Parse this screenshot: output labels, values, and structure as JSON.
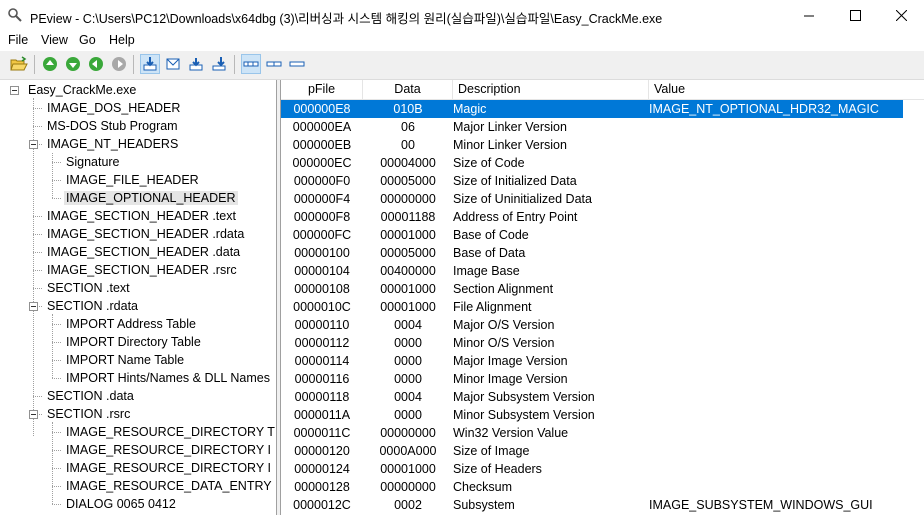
{
  "window": {
    "title": "PEview - C:\\Users\\PC12\\Downloads\\x64dbg (3)\\리버싱과 시스템 해킹의 원리(실습파일)\\실습파일\\Easy_CrackMe.exe"
  },
  "menu": [
    "File",
    "View",
    "Go",
    "Help"
  ],
  "toolbar_icons": [
    "open-icon",
    "back-icon",
    "forward-icon",
    "back-alt-icon",
    "forward-disabled-icon",
    "view-down-icon",
    "view-mail-icon",
    "view-down2-icon",
    "view-down3-icon",
    "list-mode-1-icon",
    "list-mode-2-icon",
    "list-mode-3-icon"
  ],
  "tree": [
    {
      "label": "Easy_CrackMe.exe",
      "level": 0,
      "toggle": true
    },
    {
      "label": "IMAGE_DOS_HEADER",
      "level": 1
    },
    {
      "label": "MS-DOS Stub Program",
      "level": 1
    },
    {
      "label": "IMAGE_NT_HEADERS",
      "level": 1,
      "toggle": true
    },
    {
      "label": "Signature",
      "level": 2
    },
    {
      "label": "IMAGE_FILE_HEADER",
      "level": 2
    },
    {
      "label": "IMAGE_OPTIONAL_HEADER",
      "level": 2,
      "selected": true
    },
    {
      "label": "IMAGE_SECTION_HEADER .text",
      "level": 1
    },
    {
      "label": "IMAGE_SECTION_HEADER .rdata",
      "level": 1
    },
    {
      "label": "IMAGE_SECTION_HEADER .data",
      "level": 1
    },
    {
      "label": "IMAGE_SECTION_HEADER .rsrc",
      "level": 1
    },
    {
      "label": "SECTION .text",
      "level": 1
    },
    {
      "label": "SECTION .rdata",
      "level": 1,
      "toggle": true
    },
    {
      "label": "IMPORT Address Table",
      "level": 2
    },
    {
      "label": "IMPORT Directory Table",
      "level": 2
    },
    {
      "label": "IMPORT Name Table",
      "level": 2
    },
    {
      "label": "IMPORT Hints/Names & DLL Names",
      "level": 2
    },
    {
      "label": "SECTION .data",
      "level": 1
    },
    {
      "label": "SECTION .rsrc",
      "level": 1,
      "toggle": true
    },
    {
      "label": "IMAGE_RESOURCE_DIRECTORY T",
      "level": 2
    },
    {
      "label": "IMAGE_RESOURCE_DIRECTORY I",
      "level": 2
    },
    {
      "label": "IMAGE_RESOURCE_DIRECTORY I",
      "level": 2
    },
    {
      "label": "IMAGE_RESOURCE_DATA_ENTRY",
      "level": 2
    },
    {
      "label": "DIALOG  0065  0412",
      "level": 2
    }
  ],
  "list": {
    "columns": [
      "pFile",
      "Data",
      "Description",
      "Value"
    ],
    "rows": [
      {
        "pfile": "000000E8",
        "data": "010B",
        "desc": "Magic",
        "value": "IMAGE_NT_OPTIONAL_HDR32_MAGIC",
        "selected": true
      },
      {
        "pfile": "000000EA",
        "data": "06",
        "desc": "Major Linker Version",
        "value": ""
      },
      {
        "pfile": "000000EB",
        "data": "00",
        "desc": "Minor Linker Version",
        "value": ""
      },
      {
        "pfile": "000000EC",
        "data": "00004000",
        "desc": "Size of Code",
        "value": ""
      },
      {
        "pfile": "000000F0",
        "data": "00005000",
        "desc": "Size of Initialized Data",
        "value": ""
      },
      {
        "pfile": "000000F4",
        "data": "00000000",
        "desc": "Size of Uninitialized Data",
        "value": ""
      },
      {
        "pfile": "000000F8",
        "data": "00001188",
        "desc": "Address of Entry Point",
        "value": ""
      },
      {
        "pfile": "000000FC",
        "data": "00001000",
        "desc": "Base of Code",
        "value": ""
      },
      {
        "pfile": "00000100",
        "data": "00005000",
        "desc": "Base of Data",
        "value": ""
      },
      {
        "pfile": "00000104",
        "data": "00400000",
        "desc": "Image Base",
        "value": ""
      },
      {
        "pfile": "00000108",
        "data": "00001000",
        "desc": "Section Alignment",
        "value": ""
      },
      {
        "pfile": "0000010C",
        "data": "00001000",
        "desc": "File Alignment",
        "value": ""
      },
      {
        "pfile": "00000110",
        "data": "0004",
        "desc": "Major O/S Version",
        "value": ""
      },
      {
        "pfile": "00000112",
        "data": "0000",
        "desc": "Minor O/S Version",
        "value": ""
      },
      {
        "pfile": "00000114",
        "data": "0000",
        "desc": "Major Image Version",
        "value": ""
      },
      {
        "pfile": "00000116",
        "data": "0000",
        "desc": "Minor Image Version",
        "value": ""
      },
      {
        "pfile": "00000118",
        "data": "0004",
        "desc": "Major Subsystem Version",
        "value": ""
      },
      {
        "pfile": "0000011A",
        "data": "0000",
        "desc": "Minor Subsystem Version",
        "value": ""
      },
      {
        "pfile": "0000011C",
        "data": "00000000",
        "desc": "Win32 Version Value",
        "value": ""
      },
      {
        "pfile": "00000120",
        "data": "0000A000",
        "desc": "Size of Image",
        "value": ""
      },
      {
        "pfile": "00000124",
        "data": "00001000",
        "desc": "Size of Headers",
        "value": ""
      },
      {
        "pfile": "00000128",
        "data": "00000000",
        "desc": "Checksum",
        "value": ""
      },
      {
        "pfile": "0000012C",
        "data": "0002",
        "desc": "Subsystem",
        "value": "IMAGE_SUBSYSTEM_WINDOWS_GUI"
      }
    ]
  },
  "colors": {
    "selection": "#0078d7",
    "tree_selection": "#e5e5e5",
    "toolbar_bg": "#f0f0f0"
  }
}
